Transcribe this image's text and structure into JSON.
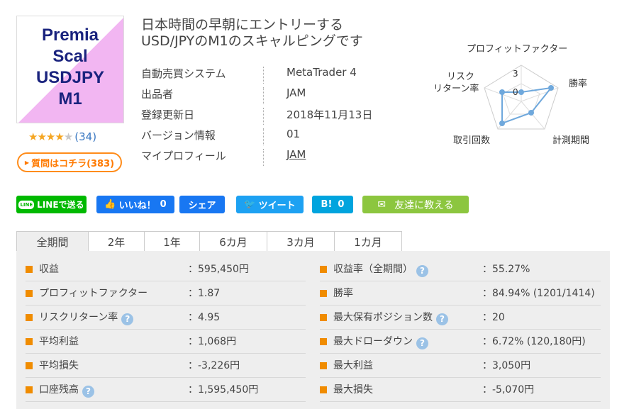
{
  "product": {
    "image_name_lines": [
      "Premia",
      "Scal",
      "USDJPY",
      "M1"
    ],
    "rating_count": "(34)",
    "question_button": "質問はコチラ(383)",
    "title_lines": [
      "日本時間の早朝にエントリーする",
      "USD/JPYのM1のスキャルピングです"
    ]
  },
  "info": [
    {
      "key": "自動売買システム",
      "value": "MetaTrader 4"
    },
    {
      "key": "出品者",
      "value": "JAM"
    },
    {
      "key": "登録更新日",
      "value": "2018年11月13日"
    },
    {
      "key": "バージョン情報",
      "value": "01"
    },
    {
      "key": "マイプロフィール",
      "value": "JAM"
    }
  ],
  "radar": {
    "labels": {
      "top": "プロフィットファクター",
      "right": "勝率",
      "bottom_right": "計測期間",
      "bottom_left": "取引回数",
      "left_1": "リスク",
      "left_2": "リターン率"
    },
    "scale_max": "3",
    "scale_min": "0",
    "accent": "#6fa8dc"
  },
  "social": {
    "line": "LINEで送る",
    "like": "いいね！",
    "like_count": "0",
    "share": "シェア",
    "tweet": "ツイート",
    "hatena": "B!",
    "hatena_count": "0",
    "friend": "友達に教える"
  },
  "tabs": [
    "全期間",
    "2年",
    "1年",
    "6カ月",
    "3カ月",
    "1カ月"
  ],
  "stats_left": [
    {
      "label": "収益",
      "value": "：595,450円"
    },
    {
      "label": "プロフィットファクター",
      "value": "：1.87"
    },
    {
      "label": "リスクリターン率",
      "value": "：4.95"
    },
    {
      "label": "平均利益",
      "value": "：1,068円"
    },
    {
      "label": "平均損失",
      "value": "：-3,226円"
    },
    {
      "label": "口座残高",
      "value": "：1,595,450円"
    }
  ],
  "stats_right": [
    {
      "label": "収益率（全期間）",
      "value": "：55.27%"
    },
    {
      "label": "勝率",
      "value": "：84.94% (1201/1414)"
    },
    {
      "label": "最大保有ポジション数",
      "value": "：20"
    },
    {
      "label": "最大ドローダウン",
      "value": "：6.72% (120,180円)"
    },
    {
      "label": "最大利益",
      "value": "：3,050円"
    },
    {
      "label": "最大損失",
      "value": "：-5,070円"
    }
  ],
  "help_glyph": "?",
  "colors": {
    "accent_orange": "#f08c00",
    "line_green": "#00b900",
    "fb_blue": "#1877f2",
    "tw_blue": "#1da1f2",
    "hatena_blue": "#00a4de",
    "friend_green": "#8cc63f"
  }
}
